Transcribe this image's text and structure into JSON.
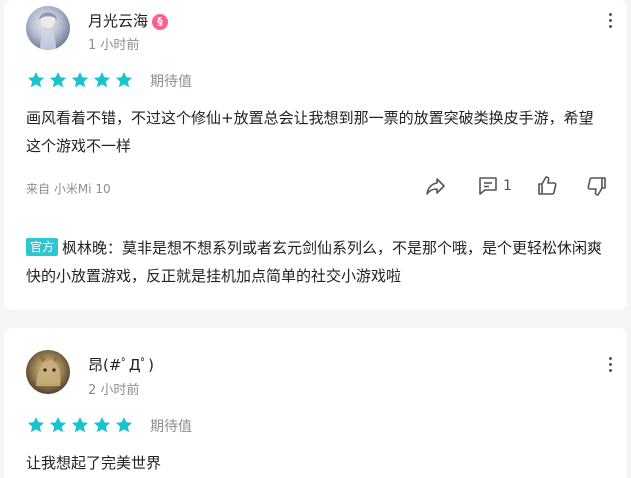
{
  "colors": {
    "star": "#16c3cf",
    "official_badge": "#2ec7d1",
    "user_badge": "#ff5f8f",
    "muted": "#8a8f96"
  },
  "reviews": [
    {
      "username": "月光云海",
      "user_badge": "§",
      "time": "1 小时前",
      "stars": 5,
      "rating_label": "期待值",
      "content": "画风看着不错，不过这个修仙+放置总会让我想到那一票的放置突破类换皮手游，希望这个游戏不一样",
      "device": "来自 小米Mi 10",
      "actions": {
        "share_icon": "share-icon",
        "comment_icon": "comment-icon",
        "comment_count": "1",
        "like_icon": "thumbs-up-icon",
        "dislike_icon": "thumbs-down-icon"
      },
      "reply": {
        "badge": "官方",
        "text": "枫林晚：莫非是想不想系列或者玄元剑仙系列么，不是那个哦，是个更轻松休闲爽快的小放置游戏，反正就是挂机加点简单的社交小游戏啦"
      }
    },
    {
      "username": "昂(#ﾟДﾟ)",
      "time": "2 小时前",
      "stars": 5,
      "rating_label": "期待值",
      "content": "让我想起了完美世界"
    }
  ]
}
